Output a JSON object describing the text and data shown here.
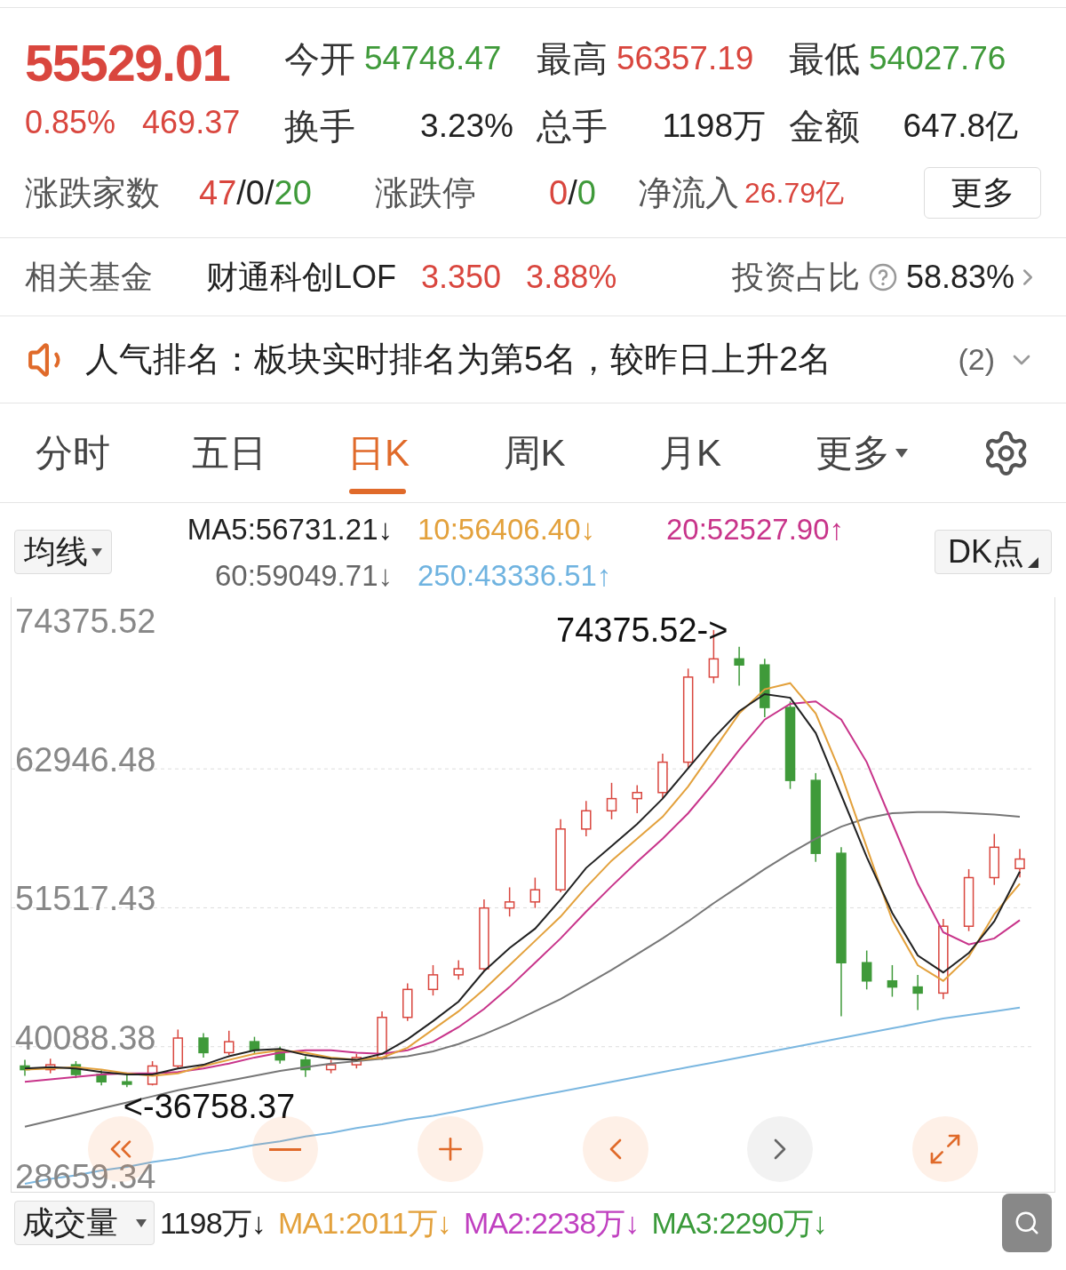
{
  "quote": {
    "price": "55529.01",
    "change_pct": "0.85%",
    "change": "469.37",
    "stats": [
      {
        "label": "今开",
        "value": "54748.47",
        "color": "#3f9a3a"
      },
      {
        "label": "最高",
        "value": "56357.19",
        "color": "#d9463e"
      },
      {
        "label": "最低",
        "value": "54027.76",
        "color": "#3f9a3a"
      },
      {
        "label": "换手",
        "value": "3.23%",
        "color": "#222222"
      },
      {
        "label": "总手",
        "value": "1198万",
        "color": "#222222"
      },
      {
        "label": "金额",
        "value": "647.8亿",
        "color": "#222222"
      }
    ],
    "breadth": [
      {
        "label": "涨跌家数",
        "parts": [
          {
            "text": "47",
            "color": "#d9463e"
          },
          {
            "text": "/0/",
            "color": "#222222"
          },
          {
            "text": "20",
            "color": "#3f9a3a"
          }
        ]
      },
      {
        "label": "涨跌停",
        "parts": [
          {
            "text": "0",
            "color": "#d9463e"
          },
          {
            "text": "/",
            "color": "#222222"
          },
          {
            "text": "0",
            "color": "#3f9a3a"
          }
        ]
      }
    ],
    "net_inflow": {
      "label": "净流入",
      "value": "26.79亿"
    },
    "more_button": "更多"
  },
  "fund": {
    "label": "相关基金",
    "name": "财通科创LOF",
    "price": "3.350",
    "change": "3.88%",
    "ratio_label": "投资占比",
    "ratio": "58.83%"
  },
  "ranking": {
    "text": "人气排名：板块实时排名为第5名，较昨日上升2名",
    "count": "(2)"
  },
  "tabs": [
    {
      "label": "分时",
      "selected": false
    },
    {
      "label": "五日",
      "selected": false
    },
    {
      "label": "日K",
      "selected": true
    },
    {
      "label": "周K",
      "selected": false
    },
    {
      "label": "月K",
      "selected": false
    },
    {
      "label": "更多",
      "selected": false
    }
  ],
  "ma_legend": {
    "selector": "均线",
    "dk_button": "DK点",
    "items": [
      {
        "text": "MA5:56731.21↓",
        "color": "#222222"
      },
      {
        "text": "10:56406.40↓",
        "color": "#e3a13c"
      },
      {
        "text": "20:52527.90↑",
        "color": "#c8348a"
      },
      {
        "text": "60:59049.71↓",
        "color": "#666666"
      },
      {
        "text": "250:43336.51↑",
        "color": "#6fb3e0"
      }
    ]
  },
  "chart": {
    "chart_data": {
      "type": "candlestick",
      "ylim": [
        28222,
        77073
      ],
      "yticks": [
        74375.52,
        62946.48,
        51517.43,
        40088.38,
        28659.34
      ],
      "grid": true,
      "ohlc": [
        [
          38500,
          39000,
          37700,
          38200
        ],
        [
          38200,
          39100,
          37900,
          38600
        ],
        [
          38600,
          38900,
          37500,
          37800
        ],
        [
          37800,
          38200,
          36900,
          37200
        ],
        [
          37200,
          37900,
          36758.37,
          37000
        ],
        [
          37000,
          38900,
          36900,
          38500
        ],
        [
          38500,
          41500,
          38300,
          40800
        ],
        [
          40800,
          41200,
          39200,
          39600
        ],
        [
          39600,
          41400,
          39400,
          40500
        ],
        [
          40500,
          40900,
          39500,
          39800
        ],
        [
          39800,
          40100,
          38700,
          39000
        ],
        [
          39000,
          39300,
          37600,
          38200
        ],
        [
          38200,
          39000,
          37900,
          38600
        ],
        [
          38600,
          39500,
          38300,
          39200
        ],
        [
          39200,
          43000,
          39000,
          42500
        ],
        [
          42500,
          45300,
          42200,
          44800
        ],
        [
          44800,
          46800,
          44300,
          46000
        ],
        [
          46000,
          47200,
          45600,
          46500
        ],
        [
          46500,
          52200,
          46300,
          51500
        ],
        [
          51500,
          53200,
          50800,
          52000
        ],
        [
          52000,
          54000,
          51500,
          53000
        ],
        [
          53000,
          58800,
          52800,
          58000
        ],
        [
          58000,
          60300,
          57400,
          59500
        ],
        [
          59500,
          61800,
          58800,
          60500
        ],
        [
          60500,
          61600,
          59300,
          61000
        ],
        [
          61000,
          64200,
          60500,
          63500
        ],
        [
          63500,
          71200,
          63000,
          70500
        ],
        [
          70500,
          74375.52,
          70000,
          72000
        ],
        [
          72000,
          73000,
          69800,
          71500
        ],
        [
          71500,
          72000,
          67200,
          68000
        ],
        [
          68000,
          68500,
          61300,
          62000
        ],
        [
          62000,
          62600,
          55300,
          56000
        ],
        [
          56000,
          56500,
          42600,
          47000
        ],
        [
          47000,
          48000,
          44800,
          45500
        ],
        [
          45500,
          46800,
          44200,
          45000
        ],
        [
          45000,
          46000,
          43100,
          44500
        ],
        [
          44500,
          50600,
          44000,
          50000
        ],
        [
          50000,
          54700,
          49600,
          54000
        ],
        [
          54000,
          57600,
          53400,
          56500
        ],
        [
          54748.47,
          56357.19,
          54027.76,
          55529.01
        ]
      ],
      "series": [
        {
          "type": "line",
          "color": "#222222",
          "values": [
            38300,
            38400,
            38300,
            38000,
            37800,
            37800,
            38300,
            38600,
            39300,
            39800,
            39900,
            39400,
            39100,
            39000,
            39500,
            40700,
            42200,
            43800,
            46300,
            48200,
            49800,
            52200,
            54800,
            56600,
            58400,
            60500,
            63000,
            65500,
            67700,
            69100,
            68800,
            65900,
            60800,
            55700,
            51100,
            47600,
            46200,
            47800,
            50400,
            54500
          ]
        },
        {
          "type": "line",
          "color": "#e3a13c",
          "values": [
            38200,
            38300,
            38400,
            38200,
            37900,
            37700,
            37900,
            38500,
            39000,
            39500,
            39800,
            39600,
            39200,
            39000,
            39200,
            40000,
            41500,
            43000,
            44800,
            46800,
            48800,
            50800,
            53200,
            55400,
            57200,
            59000,
            61500,
            64500,
            67500,
            69500,
            70000,
            67500,
            62500,
            56500,
            50500,
            46800,
            45500,
            47500,
            51000,
            53500
          ]
        },
        {
          "type": "line",
          "color": "#c8348a",
          "values": [
            37200,
            37400,
            37600,
            37800,
            37900,
            37900,
            38000,
            38300,
            38700,
            39200,
            39600,
            39800,
            39800,
            39600,
            39500,
            39800,
            40500,
            41700,
            43200,
            45000,
            47000,
            49000,
            51200,
            53300,
            55300,
            57200,
            59300,
            61800,
            64500,
            67000,
            68300,
            68500,
            67000,
            63500,
            58500,
            53500,
            49500,
            48500,
            49000,
            50500
          ]
        },
        {
          "type": "line",
          "color": "#777777",
          "values": [
            33500,
            34000,
            34500,
            35000,
            35500,
            36000,
            36500,
            36900,
            37300,
            37700,
            38100,
            38400,
            38700,
            38900,
            39100,
            39300,
            39700,
            40300,
            41100,
            42000,
            43000,
            44000,
            45200,
            46400,
            47700,
            49000,
            50400,
            51900,
            53300,
            54700,
            56000,
            57200,
            58200,
            58900,
            59300,
            59400,
            59400,
            59300,
            59200,
            59000
          ]
        },
        {
          "type": "line",
          "color": "#7bb7e0",
          "values": [
            28800,
            29200,
            29500,
            29900,
            30200,
            30600,
            30900,
            31300,
            31600,
            32000,
            32300,
            32700,
            33000,
            33400,
            33700,
            34100,
            34400,
            34800,
            35200,
            35600,
            36000,
            36400,
            36800,
            37200,
            37600,
            38000,
            38400,
            38800,
            39200,
            39600,
            40000,
            40400,
            40800,
            41200,
            41600,
            42000,
            42400,
            42700,
            43000,
            43300
          ]
        }
      ],
      "annotations": [
        "74375.52->",
        "<-36758.37"
      ]
    }
  },
  "volume": {
    "selector": "成交量",
    "items": [
      {
        "text": "1198万↓",
        "color": "#222222"
      },
      {
        "text": "MA1:2011万↓",
        "color": "#e3a13c"
      },
      {
        "text": "MA2:2238万↓",
        "color": "#c040c0"
      },
      {
        "text": "MA3:2290万↓",
        "color": "#3a9a3a"
      }
    ]
  }
}
